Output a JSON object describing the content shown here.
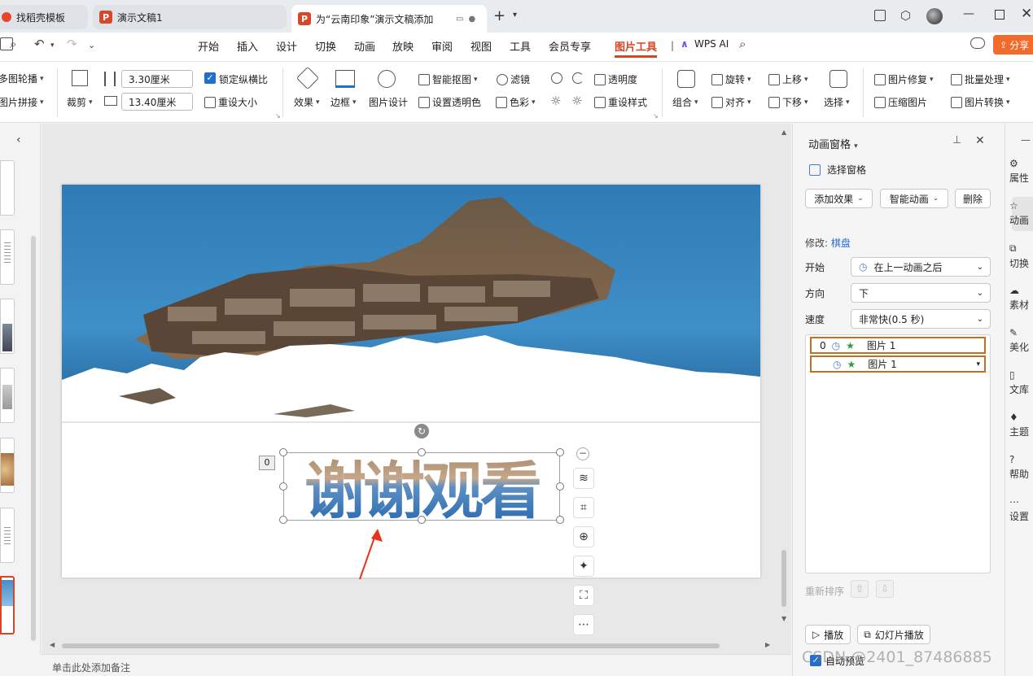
{
  "tabs": [
    {
      "label": "找稻壳模板"
    },
    {
      "label": "演示文稿1"
    },
    {
      "label": "为“云南印象”演示文稿添加"
    }
  ],
  "menu": [
    "开始",
    "插入",
    "设计",
    "切换",
    "动画",
    "放映",
    "审阅",
    "视图",
    "工具",
    "会员专享",
    "图片工具",
    "WPS AI"
  ],
  "share_label": "分享",
  "ribbon": {
    "outline": "多图轮播",
    "splice": "图片拼接",
    "crop": "裁剪",
    "height": "3.30厘米",
    "width": "13.40厘米",
    "lock_ratio": "锁定纵横比",
    "reset_size": "重设大小",
    "effect": "效果",
    "border": "边框",
    "design": "图片设计",
    "smart_cutout": "智能抠图",
    "filter": "滤镜",
    "transparency": "透明度",
    "set_transparent": "设置透明色",
    "color": "色彩",
    "reset_style": "重设样式",
    "group": "组合",
    "rotate": "旋转",
    "align": "对齐",
    "move_up": "上移",
    "move_down": "下移",
    "select": "选择",
    "repair": "图片修复",
    "batch": "批量处理",
    "compress": "压缩图片",
    "convert": "图片转换"
  },
  "slide": {
    "text": "谢谢观看",
    "anim_badge": "0"
  },
  "notes_placeholder": "单击此处添加备注",
  "panel": {
    "title": "动画窗格",
    "selection_pane": "选择窗格",
    "add_effect": "添加效果",
    "smart_anim": "智能动画",
    "delete": "删除",
    "modify_label": "修改:",
    "modify_value": "棋盘",
    "start_label": "开始",
    "start_value": "在上一动画之后",
    "direction_label": "方向",
    "direction_value": "下",
    "speed_label": "速度",
    "speed_value": "非常快(0.5 秒)",
    "items": [
      {
        "index": "0",
        "label": "图片 1"
      },
      {
        "index": "",
        "label": "图片 1"
      }
    ],
    "reorder": "重新排序",
    "play": "播放",
    "slideshow": "幻灯片播放",
    "auto_preview": "自动预览",
    "watermark": "CSDN @2401_87486885"
  },
  "rail": [
    "属性",
    "动画",
    "切换",
    "素材",
    "美化",
    "文库",
    "主题",
    "帮助",
    "设置"
  ],
  "colors": {
    "accent": "#d24726",
    "selection": "#c2701f",
    "arrow": "#e8331c",
    "check": "#1f6fd1"
  }
}
